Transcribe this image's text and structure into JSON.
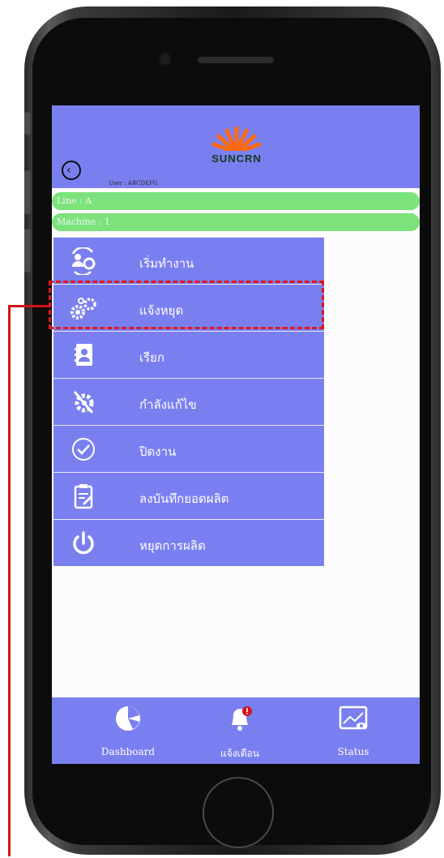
{
  "header": {
    "brand_name": "SUNCRN",
    "user_text": "User : ABCDEFG"
  },
  "status": {
    "line_label": "Line : A",
    "machine_label": "Machine : 1"
  },
  "menu": {
    "items": [
      {
        "label": "เริ่มทำงาน",
        "icon": "user-sync-icon"
      },
      {
        "label": "แจ้งหยุด",
        "icon": "gears-icon"
      },
      {
        "label": "เรียก",
        "icon": "contact-book-icon"
      },
      {
        "label": "กำลังแก้ไข",
        "icon": "gear-wrench-icon"
      },
      {
        "label": "ปิดงาน",
        "icon": "check-circle-icon"
      },
      {
        "label": "ลงบันทึกยอดผลิต",
        "icon": "clipboard-edit-icon"
      },
      {
        "label": "หยุดการผลิต",
        "icon": "power-icon"
      }
    ]
  },
  "bottom_nav": {
    "tabs": [
      {
        "label": "Dashboard",
        "icon": "pie-chart-icon"
      },
      {
        "label": "แจ้งเตือน",
        "icon": "bell-alert-icon"
      },
      {
        "label": "Status",
        "icon": "status-chart-icon"
      }
    ]
  },
  "colors": {
    "header_bg": "#7a7ff0",
    "pill_bg": "#7ce37c",
    "highlight": "#e01818"
  }
}
